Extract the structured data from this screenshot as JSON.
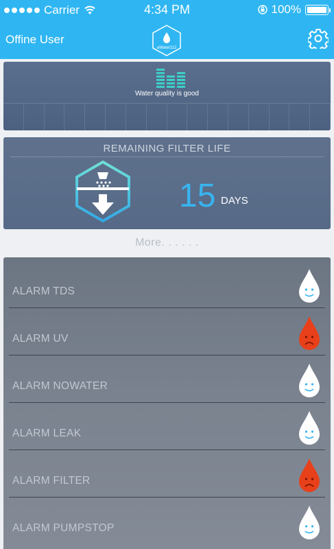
{
  "status_bar": {
    "carrier": "Carrier",
    "time": "4:34 PM",
    "battery": "100%"
  },
  "header": {
    "user": "Offine User",
    "logo_text": "aWater112",
    "settings_icon": "gear-icon"
  },
  "quality": {
    "text": "Water quality is good",
    "icon": "bars-icon"
  },
  "filter": {
    "title": "REMAINING FILTER LIFE",
    "days_value": "15",
    "days_label": "DAYS",
    "icon": "filter-hex-icon"
  },
  "more_label": "More. . . . . .",
  "alarms": [
    {
      "label": "ALARM TDS",
      "state": "ok"
    },
    {
      "label": "ALARM UV",
      "state": "alert"
    },
    {
      "label": "ALARM NOWATER",
      "state": "ok"
    },
    {
      "label": "ALARM LEAK",
      "state": "ok"
    },
    {
      "label": "ALARM FILTER",
      "state": "alert"
    },
    {
      "label": "ALARM PUMPSTOP",
      "state": "ok"
    }
  ],
  "colors": {
    "brand": "#2fb6f2",
    "days_number": "#38b4f0",
    "ok_drop": "#ffffff",
    "ok_face": "#38b4f0",
    "alert_drop": "#e8401a",
    "alert_face": "#7a1400"
  }
}
